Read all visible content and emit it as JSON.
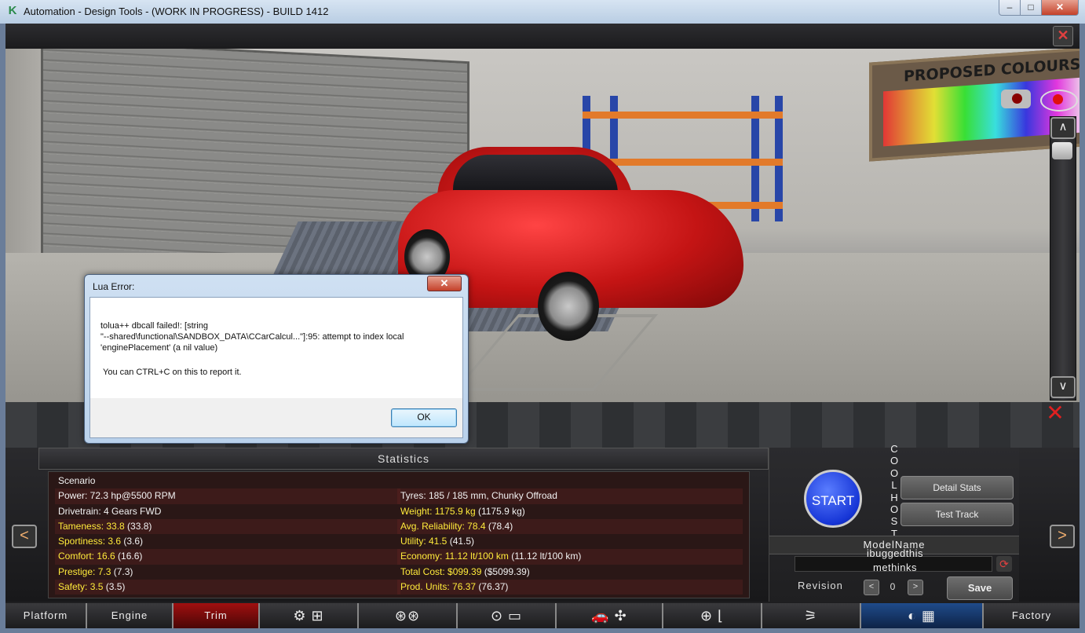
{
  "window": {
    "title": "Automation - Design Tools - (WORK IN PROGRESS) - BUILD 1412",
    "app_icon": "K",
    "minimize": "‒",
    "maximize": "□",
    "close": "✕"
  },
  "scene": {
    "close_glyph": "✕",
    "board_title": "PROPOSED COLOURS",
    "scroll_up": "∧",
    "scroll_down": "∨",
    "hide_glyph": "✕"
  },
  "dialog": {
    "title": "Lua Error:",
    "close_glyph": "✕",
    "message": "tolua++ dbcall failed!: [string\n\"--shared\\functional\\SANDBOX_DATA\\CCarCalcul...\"]:95: attempt to index local\n'enginePlacement' (a nil value)",
    "hint": "You can CTRL+C on this to report it.",
    "ok_label": "OK"
  },
  "stats": {
    "header": "Statistics",
    "left": [
      {
        "label": "Scenario",
        "value": ""
      },
      {
        "label": "Power: 72.3 hp@5500 RPM",
        "value": ""
      },
      {
        "label": "Drivetrain: 4 Gears FWD",
        "value": ""
      },
      {
        "label": "Tameness: 33.8",
        "value": " (33.8)"
      },
      {
        "label": "Sportiness: 3.6",
        "value": " (3.6)"
      },
      {
        "label": "Comfort: 16.6",
        "value": " (16.6)"
      },
      {
        "label": "Prestige: 7.3",
        "value": " (7.3)"
      },
      {
        "label": "Safety: 3.5",
        "value": " (3.5)"
      }
    ],
    "right": [
      {
        "label": "",
        "value": ""
      },
      {
        "label": "Tyres: 185 / 185 mm, Chunky Offroad",
        "value": ""
      },
      {
        "label": "Weight: 1175.9 kg",
        "value": " (1175.9 kg)"
      },
      {
        "label": "Avg. Reliability: 78.4",
        "value": " (78.4)"
      },
      {
        "label": "Utility: 41.5",
        "value": " (41.5)"
      },
      {
        "label": "Economy: 11.12 lt/100 km",
        "value": " (11.12 lt/100 km)"
      },
      {
        "label": "Total Cost: $099.39",
        "value": " ($5099.39)"
      },
      {
        "label": "Prod. Units: 76.37",
        "value": " (76.37)"
      }
    ],
    "highlight_color": "#ffeb3b"
  },
  "controls": {
    "nav_prev": "<",
    "nav_next": ">",
    "start_label": "START",
    "vertical_text": "COOLHOST",
    "detail_stats_label": "Detail Stats",
    "test_track_label": "Test Track",
    "model_name_label": "ModelName",
    "model_name_value": "ibuggedthis methinks",
    "refresh_glyph": "⟳",
    "revision_label": "Revision",
    "revision_prev": "<",
    "revision_value": "0",
    "revision_next": ">",
    "save_label": "Save"
  },
  "tabs": [
    {
      "label": "Platform",
      "active": false
    },
    {
      "label": "Engine",
      "active": false
    },
    {
      "label": "Trim",
      "active": true
    },
    {
      "label": "⚙ ⊞",
      "icon": "gearbox-icon",
      "active": false
    },
    {
      "label": "⊛⊛",
      "icon": "wheels-icon",
      "active": false
    },
    {
      "label": "⊙ ▭",
      "icon": "brakes-icon",
      "active": false
    },
    {
      "label": "🚗 ✣",
      "icon": "car-fan-icon",
      "active": false
    },
    {
      "label": "⊕ ⌊",
      "icon": "interior-icon",
      "active": false
    },
    {
      "label": "⚞",
      "icon": "suspension-icon",
      "active": false
    },
    {
      "label": "◐ ▦",
      "icon": "test-flag-icon",
      "active": false
    },
    {
      "label": "Factory",
      "active": false
    }
  ]
}
